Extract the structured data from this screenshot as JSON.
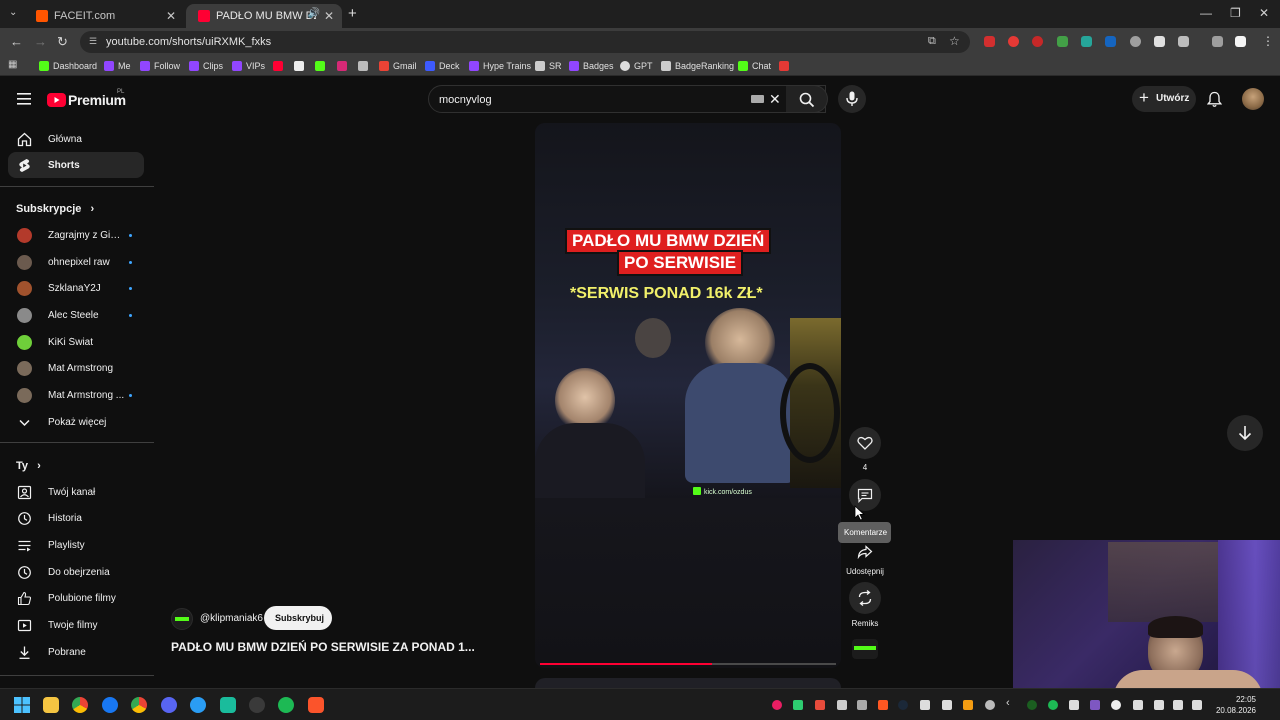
{
  "browser": {
    "tabs": [
      {
        "title": "FACEIT.com",
        "active": false
      },
      {
        "title": "PADŁO MU BMW DZIEŃ PO",
        "active": true
      }
    ],
    "url": "youtube.com/shorts/uiRXMK_fxks",
    "bookmarks": [
      "Dashboard",
      "Me",
      "Follow",
      "Clips",
      "VIPs",
      "Gmail",
      "Deck",
      "Hype Trains",
      "SR",
      "Badges",
      "GPT",
      "BadgeRanking",
      "Chat"
    ]
  },
  "youtube": {
    "logo_text": "Premium",
    "logo_region": "PL",
    "search_value": "mocnyvlog",
    "create_label": "Utwórz"
  },
  "sidebar": {
    "main": [
      {
        "label": "Główna",
        "icon": "home-icon"
      },
      {
        "label": "Shorts",
        "icon": "shorts-icon"
      }
    ],
    "subscriptions_title": "Subskrypcje",
    "subscriptions": [
      {
        "label": "Zagrajmy z Gimp...",
        "color": "#b33a2b"
      },
      {
        "label": "ohnepixel raw",
        "color": "#6b5a4e"
      },
      {
        "label": "SzklanaY2J",
        "color": "#a0522d"
      },
      {
        "label": "Alec Steele",
        "color": "#8a8a8a"
      },
      {
        "label": "KiKi Świat",
        "color": "#6fcf3a"
      },
      {
        "label": "Mat Armstrong",
        "color": "#7a6a5a"
      },
      {
        "label": "Mat Armstrong ...",
        "color": "#7a6a5a"
      }
    ],
    "show_more": "Pokaż więcej",
    "you_title": "Ty",
    "you_items": [
      {
        "label": "Twój kanał",
        "icon": "channel-icon"
      },
      {
        "label": "Historia",
        "icon": "history-icon"
      },
      {
        "label": "Playlisty",
        "icon": "playlist-icon"
      },
      {
        "label": "Do obejrzenia",
        "icon": "watch-later-icon"
      },
      {
        "label": "Polubione filmy",
        "icon": "like-icon"
      },
      {
        "label": "Twoje filmy",
        "icon": "video-icon"
      },
      {
        "label": "Pobrane",
        "icon": "download-icon"
      }
    ]
  },
  "short": {
    "caption_line1": "PADŁO MU BMW DZIEŃ",
    "caption_line2": "PO SERWISIE",
    "caption_yellow": "*SERWIS PONAD 16k ZŁ*",
    "watermark": "kick.com/ozdus",
    "channel": "@klipmaniak6",
    "subscribe_label": "Subskrybuj",
    "title": "PADŁO MU BMW DZIEŃ PO SERWISIE ZA PONAD 1...",
    "progress": 0.58,
    "likes": "4",
    "comments_tooltip": "Komentarze",
    "share_label": "Udostępnij",
    "remix_label": "Remiks"
  },
  "taskbar": {
    "time": "22:05",
    "date": "20.08.2026"
  }
}
